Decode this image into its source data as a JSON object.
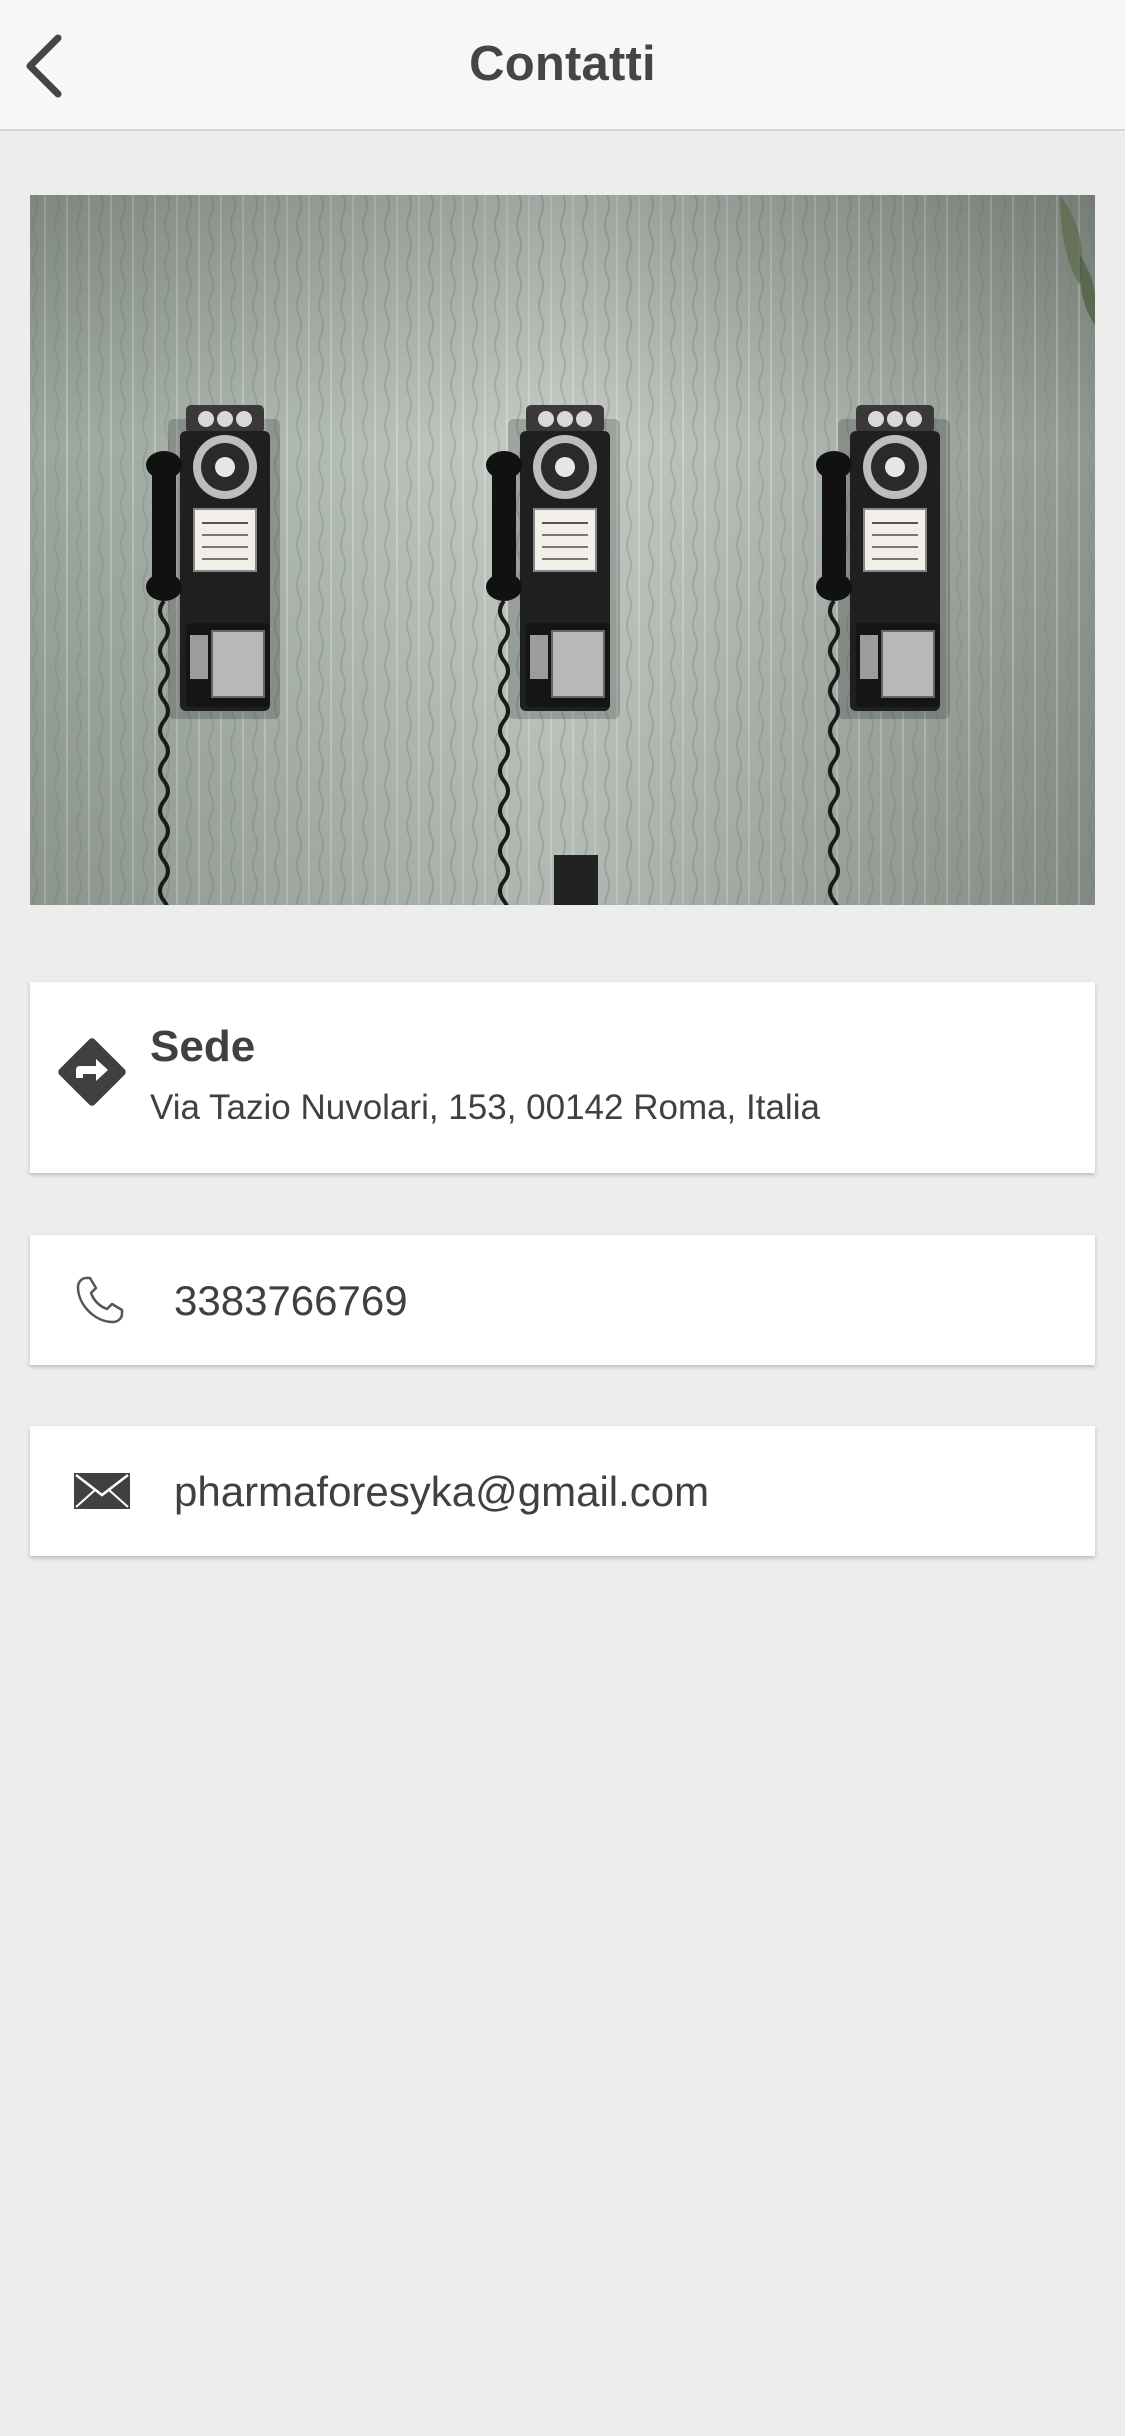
{
  "header": {
    "title": "Contatti",
    "back_icon": "chevron-left-icon"
  },
  "hero_image": {
    "subject": "three vintage wall-mounted payphones on striped wallpaper"
  },
  "address_card": {
    "icon": "directions-icon",
    "title": "Sede",
    "address": "Via Tazio Nuvolari, 153, 00142 Roma, Italia"
  },
  "phone_card": {
    "icon": "phone-icon",
    "value": "3383766769"
  },
  "email_card": {
    "icon": "envelope-icon",
    "value": "pharmaforesyka@gmail.com"
  },
  "colors": {
    "background": "#ededed",
    "navbar": "#f7f7f7",
    "text": "#404040",
    "card": "#ffffff"
  }
}
